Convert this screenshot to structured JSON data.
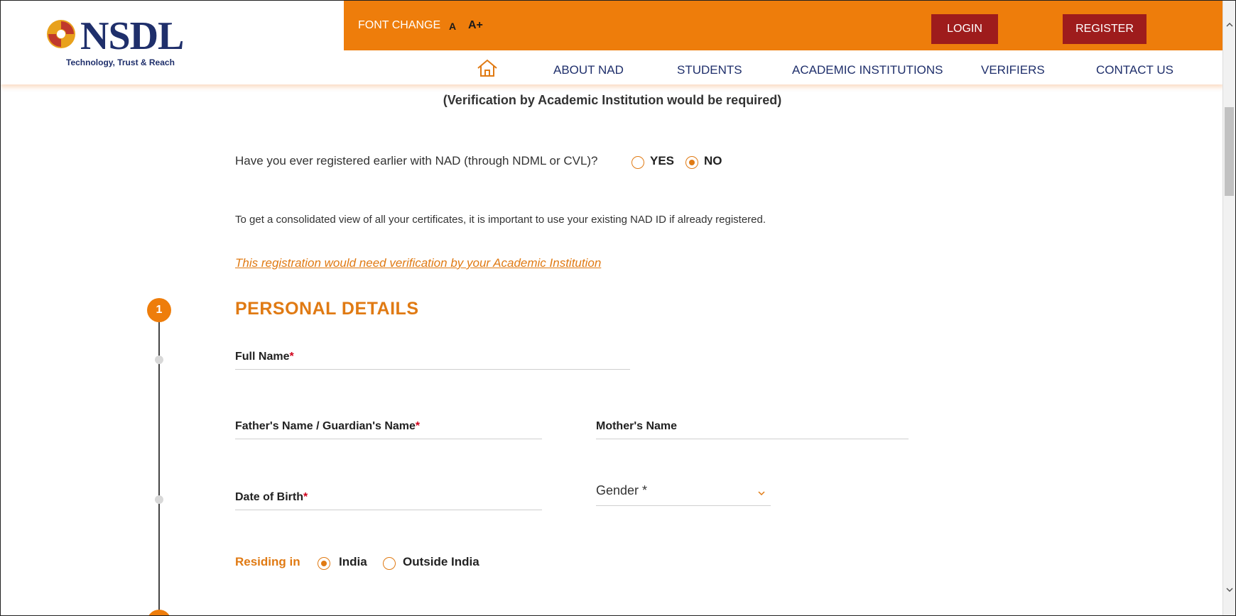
{
  "brand": {
    "name": "NSDL",
    "tagline": "Technology, Trust & Reach",
    "accent_color": "#ee7d0b",
    "button_color": "#9e1c1c",
    "nav_text_color": "#1f2f6b"
  },
  "topbar": {
    "font_change_label": "FONT CHANGE",
    "font_small": "A",
    "font_large": "A+",
    "login_label": "LOGIN",
    "register_label": "REGISTER"
  },
  "nav": {
    "home_icon": "home-icon",
    "items": [
      {
        "label": "ABOUT NAD"
      },
      {
        "label": "STUDENTS"
      },
      {
        "label": "ACADEMIC INSTITUTIONS"
      },
      {
        "label": "VERIFIERS"
      },
      {
        "label": "CONTACT US"
      }
    ]
  },
  "page": {
    "verification_note": "(Verification by Academic Institution would be required)",
    "question": "Have you ever registered earlier with NAD (through NDML or CVL)?",
    "yes_label": "YES",
    "no_label": "NO",
    "selected_answer": "NO",
    "info_text": "To get a consolidated view of all your certificates, it is important to use your existing NAD ID if already registered.",
    "warning_link": "This registration would need verification by your Academic Institution"
  },
  "step1": {
    "number": "1",
    "title": "PERSONAL DETAILS",
    "fields": {
      "full_name": "Full Name",
      "father_name": "Father's Name / Guardian's Name",
      "mother_name": "Mother's Name",
      "dob": "Date of Birth",
      "required_mark": "*"
    },
    "gender": {
      "label": "Gender *",
      "value": ""
    },
    "residing": {
      "label": "Residing in",
      "options": [
        "India",
        "Outside India"
      ],
      "selected": "India"
    }
  }
}
